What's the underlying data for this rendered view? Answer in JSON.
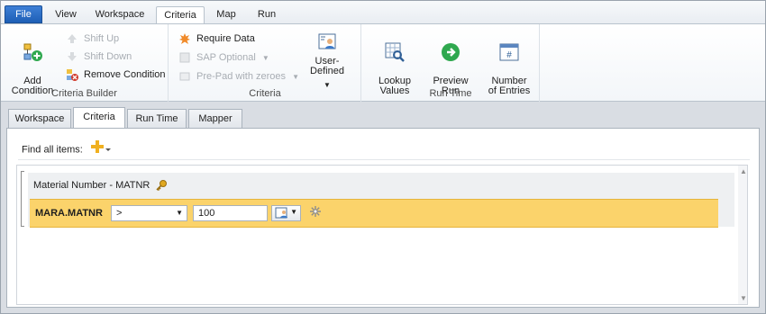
{
  "ribbon_tabs": [
    "File",
    "View",
    "Workspace",
    "Criteria",
    "Map",
    "Run"
  ],
  "groups": {
    "criteria_builder": {
      "label": "Criteria Builder",
      "add_condition": "Add\nCondition",
      "shift_up": "Shift Up",
      "shift_down": "Shift Down",
      "remove_condition": "Remove Condition"
    },
    "criteria": {
      "label": "Criteria",
      "require_data": "Require Data",
      "sap_optional": "SAP Optional",
      "pre_pad": "Pre-Pad with zeroes",
      "user_defined": "User-Defined"
    },
    "run_time": {
      "label": "Run Time",
      "lookup_values": "Lookup\nValues",
      "preview_run": "Preview\nRun",
      "number_of_entries": "Number\nof Entries"
    }
  },
  "doc_tabs": [
    "Workspace",
    "Criteria",
    "Run Time",
    "Mapper"
  ],
  "active_doc_tab": "Criteria",
  "find_all_items": "Find all items:",
  "condition": {
    "title": "Material Number - MATNR",
    "field": "MARA.MATNR",
    "operator": ">",
    "value": "100"
  },
  "colors": {
    "condition_bar": "#fbd36b",
    "file_tab": "#2a6cc4"
  }
}
